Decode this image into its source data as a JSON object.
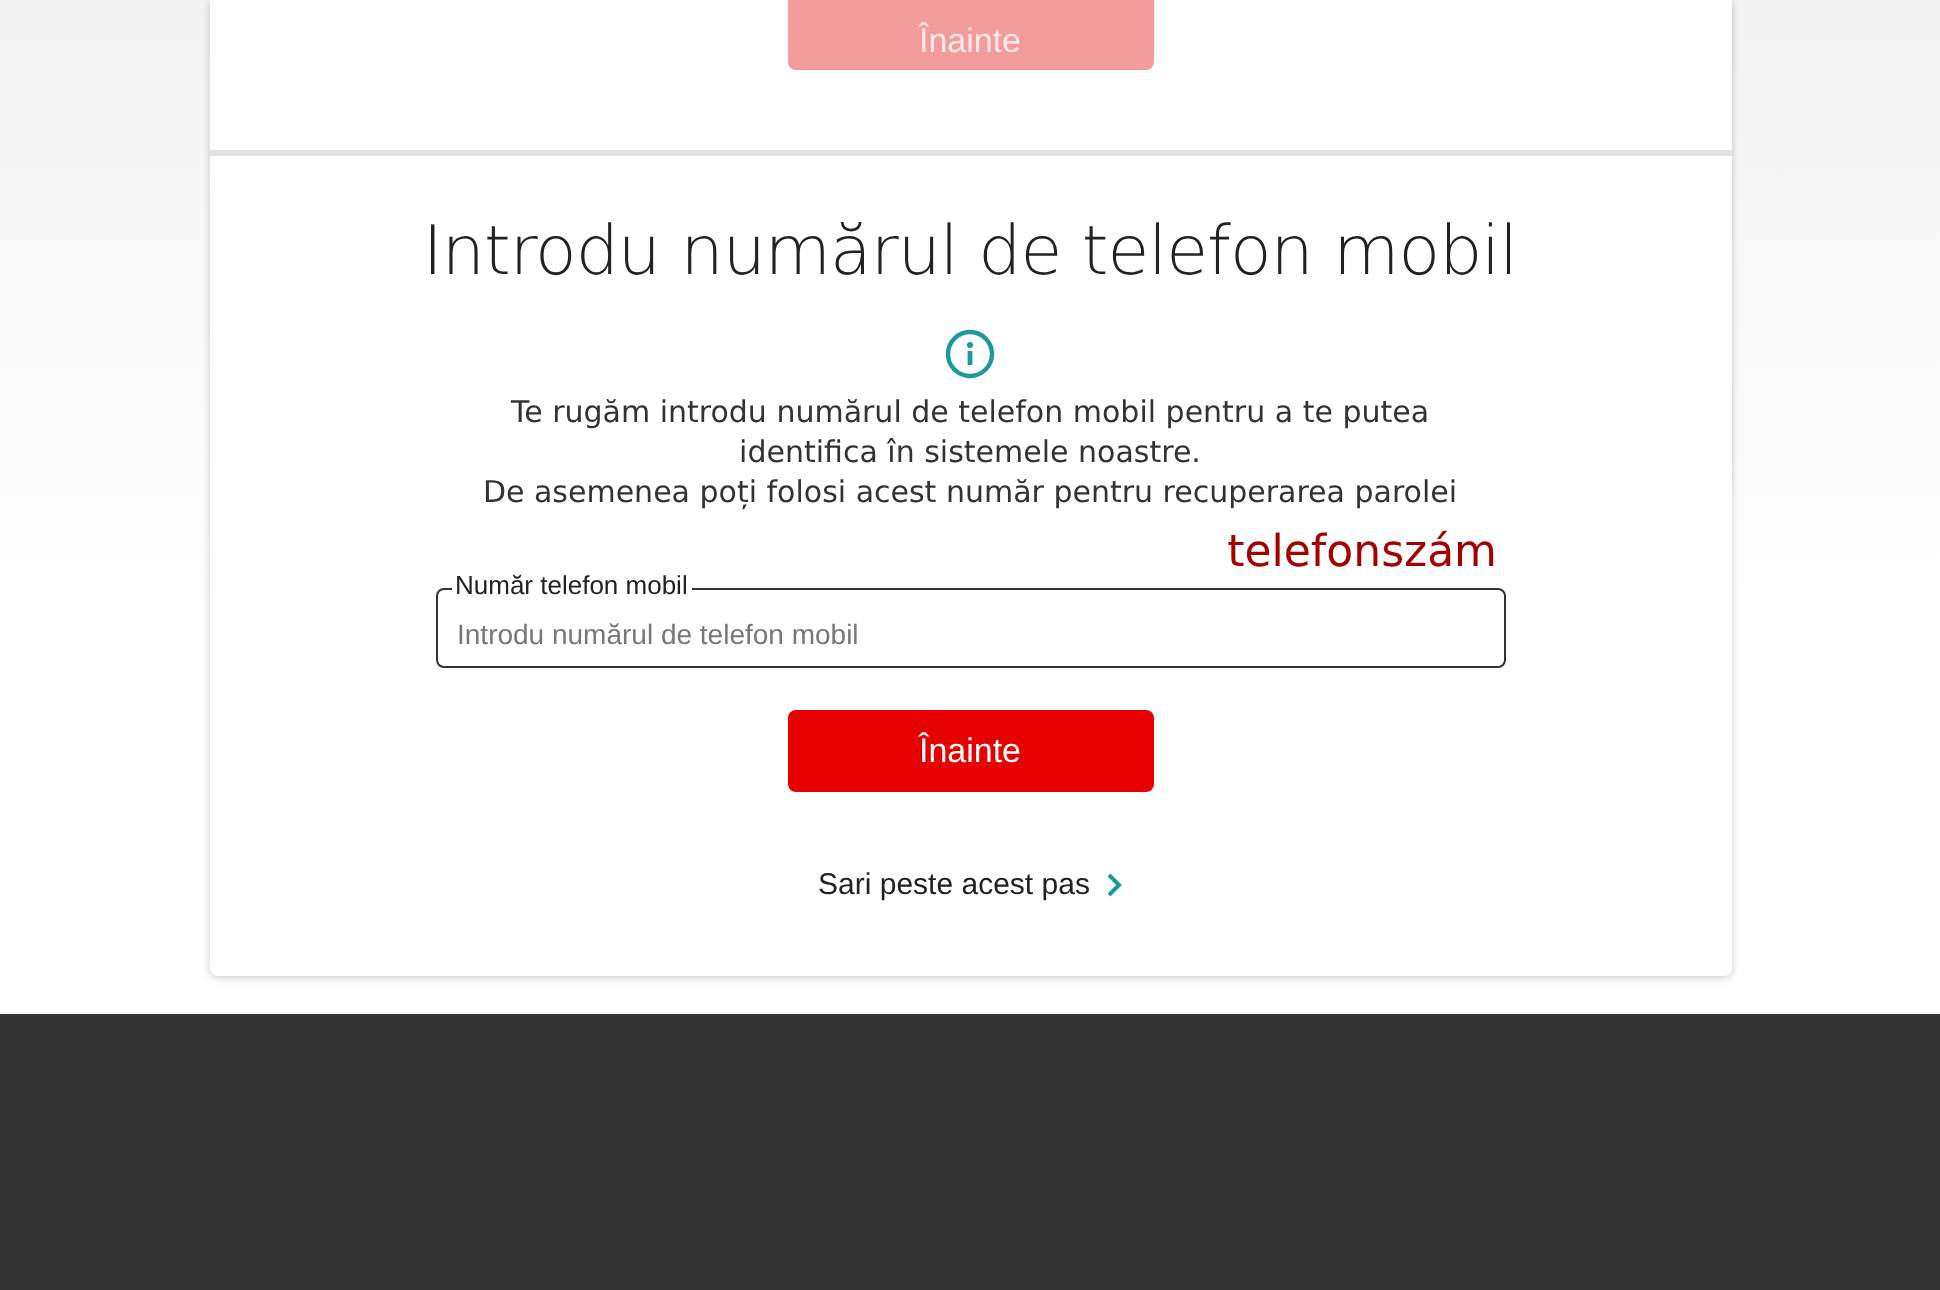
{
  "previous_step": {
    "button": {
      "label": "Înainte",
      "disabled": true
    }
  },
  "phone_step": {
    "title": "Introdu numărul de telefon mobil",
    "description": [
      "Te rugăm introdu numărul de telefon mobil pentru a te putea identifica în sistemele noastre.",
      "De asemenea poți folosi acest număr pentru recuperarea parolei"
    ],
    "field": {
      "label": "Număr telefon mobil",
      "placeholder": "Introdu numărul de telefon mobil"
    },
    "annotation": "telefonszám",
    "button": {
      "label": "Înainte",
      "disabled": false
    },
    "skip_link": "Sari peste acest pas"
  }
}
